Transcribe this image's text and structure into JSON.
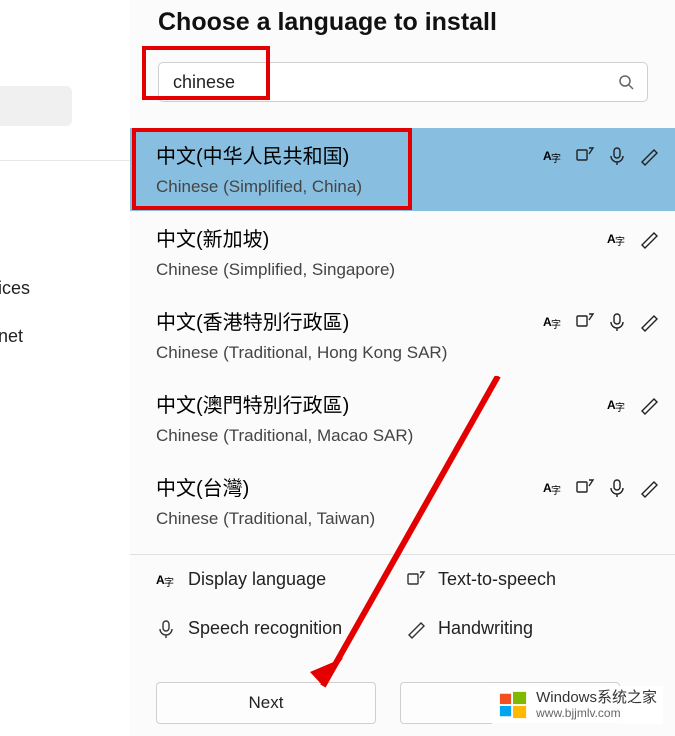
{
  "title": "Choose a language to install",
  "search": {
    "value": "chinese",
    "placeholder": ""
  },
  "sidebar": {
    "items": [
      "ices",
      "net"
    ]
  },
  "languages": [
    {
      "native": "中文(中华人民共和国)",
      "latin": "Chinese (Simplified, China)",
      "selected": true,
      "features": [
        "display",
        "tts",
        "speech",
        "handwriting"
      ]
    },
    {
      "native": "中文(新加坡)",
      "latin": "Chinese (Simplified, Singapore)",
      "selected": false,
      "features": [
        "display",
        "handwriting"
      ]
    },
    {
      "native": "中文(香港特別行政區)",
      "latin": "Chinese (Traditional, Hong Kong SAR)",
      "selected": false,
      "features": [
        "display",
        "tts",
        "speech",
        "handwriting"
      ]
    },
    {
      "native": "中文(澳門特別行政區)",
      "latin": "Chinese (Traditional, Macao SAR)",
      "selected": false,
      "features": [
        "display",
        "handwriting"
      ]
    },
    {
      "native": "中文(台灣)",
      "latin": "Chinese (Traditional, Taiwan)",
      "selected": false,
      "features": [
        "display",
        "tts",
        "speech",
        "handwriting"
      ]
    }
  ],
  "legend": {
    "display": "Display language",
    "tts": "Text-to-speech",
    "speech": "Speech recognition",
    "handwriting": "Handwriting"
  },
  "buttons": {
    "next": "Next"
  },
  "watermark": {
    "main": "Windows系统之家",
    "sub": "www.bjjmlv.com"
  },
  "icon_names": {
    "display": "display-language-icon",
    "tts": "text-to-speech-icon",
    "speech": "speech-recognition-icon",
    "handwriting": "handwriting-icon"
  }
}
